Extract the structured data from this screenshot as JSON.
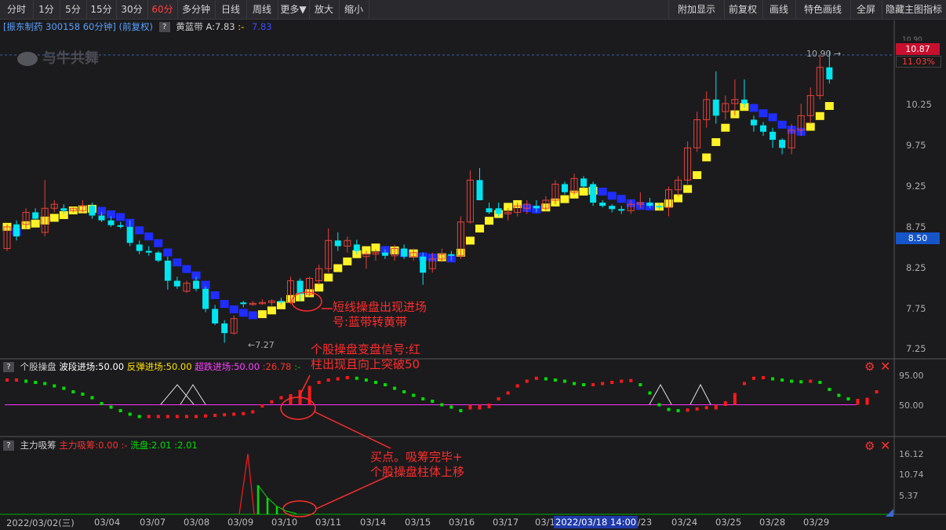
{
  "toolbar": {
    "left": [
      "分时",
      "1分",
      "5分",
      "15分",
      "30分",
      "60分",
      "多分钟",
      "日线",
      "周线",
      "更多▼",
      "放大",
      "缩小"
    ],
    "active": "60分",
    "right": [
      "附加显示",
      "前复权",
      "画线",
      "特色画线",
      "全屏",
      "隐藏主图指标"
    ]
  },
  "main_header": {
    "stock": "[振东制药 300158 60分钟]",
    "adjust": "(前复权)",
    "indicator": "黄蓝带",
    "value_a": "A:7.83",
    "sep": ":-",
    "value_b": "7.83"
  },
  "watermark": "与牛共舞",
  "price_axis": [
    "10.25",
    "9.75",
    "9.25",
    "8.75",
    "8.25",
    "7.75",
    "7.25"
  ],
  "price_tags": {
    "top": "10.87",
    "pct": "11.03%",
    "mid": "8.50",
    "top_axis_partial": "10.90"
  },
  "high_label": "10.90",
  "low_label": "7.27",
  "sub1": {
    "question": "?",
    "name": "个股操盘",
    "l1": "波段进场:50.00",
    "l2": "反弹进场:50.00",
    "l3": "超跌进场:50.00",
    "l4": ":26.78",
    "l5": ":-",
    "axis": [
      "95.00",
      "50.00"
    ]
  },
  "sub2": {
    "question": "?",
    "name": "主力吸筹",
    "l1": "主力吸筹:0.00",
    "l2": ":-",
    "l3": "洗盘:2.01",
    "l4": ":2.01",
    "axis": [
      "16.12",
      "10.74",
      "5.37"
    ]
  },
  "annotations": {
    "a1_line1": "短线操盘出现进场",
    "a1_line2": "号:蓝带转黄带",
    "a2_line1": "个股操盘变盘信号:红",
    "a2_line2": "柱出现且向上突破50",
    "a3_line1": "买点。吸筹完毕+",
    "a3_line2": "个股操盘柱体上移"
  },
  "date_axis": [
    "2022/03/02(三)",
    "03/04",
    "03/07",
    "03/08",
    "03/09",
    "03/10",
    "03/11",
    "03/14",
    "03/15",
    "03/16",
    "03/17",
    "03/1",
    "03/22",
    "03/23",
    "03/24",
    "03/25",
    "03/28",
    "03/29"
  ],
  "crosshair_date": "2022/03/18 14:00",
  "colors": {
    "bg": "#1b1b1d",
    "up": "#e8413a",
    "down": "#00e5f0",
    "band_yellow": "#fff227",
    "band_blue": "#1f2dff",
    "signal_green": "#00e000",
    "signal_red": "#ff1a1a",
    "midline": "#ff30ff",
    "annotation": "#ff2d2d"
  },
  "chart_data": {
    "type": "candlestick",
    "ylim": [
      7.1,
      11.0
    ],
    "candles": [
      [
        8.45,
        8.75,
        8.42,
        8.72
      ],
      [
        8.75,
        8.8,
        8.55,
        8.6
      ],
      [
        8.75,
        8.95,
        8.7,
        8.9
      ],
      [
        8.9,
        8.95,
        8.8,
        8.82
      ],
      [
        8.65,
        9.3,
        8.6,
        8.95
      ],
      [
        8.95,
        9.05,
        8.9,
        9.0
      ],
      [
        8.95,
        9.0,
        8.88,
        8.92
      ],
      [
        8.92,
        8.96,
        8.9,
        8.95
      ],
      [
        8.92,
        9.05,
        8.9,
        8.98
      ],
      [
        8.98,
        9.02,
        8.82,
        8.86
      ],
      [
        8.86,
        8.9,
        8.78,
        8.8
      ],
      [
        8.8,
        8.85,
        8.72,
        8.74
      ],
      [
        8.74,
        8.78,
        8.7,
        8.72
      ],
      [
        8.72,
        8.8,
        8.48,
        8.52
      ],
      [
        8.5,
        8.55,
        8.38,
        8.42
      ],
      [
        8.42,
        8.48,
        8.36,
        8.4
      ],
      [
        8.4,
        8.42,
        8.28,
        8.3
      ],
      [
        8.3,
        8.35,
        7.94,
        8.05
      ],
      [
        8.05,
        8.1,
        7.95,
        7.98
      ],
      [
        7.92,
        8.05,
        7.9,
        8.02
      ],
      [
        8.05,
        8.1,
        7.92,
        7.95
      ],
      [
        7.95,
        7.98,
        7.66,
        7.7
      ],
      [
        7.7,
        7.75,
        7.5,
        7.52
      ],
      [
        7.52,
        7.56,
        7.28,
        7.4
      ],
      [
        7.4,
        7.62,
        7.38,
        7.58
      ],
      [
        7.78,
        7.8,
        7.72,
        7.76
      ],
      [
        7.76,
        7.8,
        7.74,
        7.77
      ],
      [
        7.77,
        7.82,
        7.75,
        7.78
      ],
      [
        7.78,
        7.82,
        7.74,
        7.8
      ],
      [
        7.8,
        7.84,
        7.75,
        7.78
      ],
      [
        7.78,
        8.1,
        7.76,
        8.05
      ],
      [
        8.05,
        8.08,
        7.8,
        7.88
      ],
      [
        7.88,
        8.1,
        7.86,
        8.08
      ],
      [
        8.05,
        8.25,
        8.0,
        8.2
      ],
      [
        8.2,
        8.7,
        8.15,
        8.55
      ],
      [
        8.55,
        8.65,
        8.42,
        8.48
      ],
      [
        8.48,
        8.6,
        8.4,
        8.55
      ],
      [
        8.5,
        8.56,
        8.38,
        8.42
      ],
      [
        8.35,
        8.42,
        8.2,
        8.38
      ],
      [
        8.38,
        8.44,
        8.3,
        8.4
      ],
      [
        8.4,
        8.44,
        8.32,
        8.36
      ],
      [
        8.36,
        8.5,
        8.3,
        8.45
      ],
      [
        8.45,
        8.5,
        8.32,
        8.35
      ],
      [
        8.35,
        8.45,
        8.3,
        8.4
      ],
      [
        8.35,
        8.4,
        8.0,
        8.15
      ],
      [
        8.2,
        8.4,
        8.15,
        8.32
      ],
      [
        8.32,
        8.45,
        8.28,
        8.38
      ],
      [
        8.38,
        8.42,
        8.3,
        8.36
      ],
      [
        8.36,
        8.85,
        8.32,
        8.78
      ],
      [
        8.78,
        9.42,
        8.76,
        9.3
      ],
      [
        9.3,
        9.45,
        9.05,
        9.05
      ],
      [
        8.95,
        9.02,
        8.88,
        8.9
      ],
      [
        8.95,
        9.02,
        8.85,
        8.88
      ],
      [
        8.88,
        8.95,
        8.8,
        8.9
      ],
      [
        8.9,
        9.02,
        8.85,
        8.98
      ],
      [
        8.95,
        9.05,
        8.88,
        9.0
      ],
      [
        8.98,
        9.05,
        8.9,
        8.95
      ],
      [
        8.95,
        9.1,
        8.92,
        9.05
      ],
      [
        9.05,
        9.3,
        9.0,
        9.25
      ],
      [
        9.25,
        9.28,
        9.12,
        9.15
      ],
      [
        9.15,
        9.38,
        9.12,
        9.32
      ],
      [
        9.32,
        9.35,
        9.2,
        9.22
      ],
      [
        9.25,
        9.28,
        8.98,
        9.02
      ],
      [
        9.02,
        9.05,
        8.96,
        8.98
      ],
      [
        8.98,
        9.0,
        8.9,
        8.94
      ],
      [
        8.94,
        8.98,
        8.88,
        8.92
      ],
      [
        8.92,
        9.05,
        8.88,
        9.0
      ],
      [
        9.0,
        9.15,
        8.95,
        9.02
      ],
      [
        9.02,
        9.08,
        8.95,
        8.98
      ],
      [
        8.98,
        9.02,
        8.93,
        8.96
      ],
      [
        8.96,
        9.22,
        8.85,
        9.18
      ],
      [
        9.18,
        9.35,
        9.1,
        9.3
      ],
      [
        9.3,
        9.78,
        9.25,
        9.7
      ],
      [
        9.7,
        10.15,
        9.65,
        10.05
      ],
      [
        10.05,
        10.4,
        9.95,
        10.3
      ],
      [
        10.3,
        10.65,
        10.0,
        10.1
      ],
      [
        10.15,
        10.35,
        10.05,
        10.25
      ],
      [
        10.25,
        10.55,
        10.1,
        10.3
      ],
      [
        10.3,
        10.55,
        10.2,
        10.25
      ],
      [
        10.05,
        10.1,
        9.9,
        9.98
      ],
      [
        9.98,
        10.02,
        9.85,
        9.9
      ],
      [
        9.9,
        9.95,
        9.7,
        9.8
      ],
      [
        9.8,
        9.82,
        9.62,
        9.7
      ],
      [
        9.7,
        10.0,
        9.62,
        9.92
      ],
      [
        9.92,
        10.25,
        9.85,
        10.1
      ],
      [
        10.1,
        10.45,
        10.0,
        10.35
      ],
      [
        10.35,
        10.85,
        10.3,
        10.7
      ],
      [
        10.7,
        10.9,
        10.5,
        10.55
      ]
    ],
    "sub1_values": [
      92,
      92,
      90,
      88,
      86,
      82,
      78,
      72,
      68,
      62,
      52,
      46,
      40,
      34,
      30,
      30,
      30,
      30,
      30,
      30,
      30,
      31,
      32,
      33,
      34,
      35,
      38,
      48,
      55,
      62,
      68,
      75,
      82,
      88,
      92,
      94,
      96,
      95,
      92,
      88,
      84,
      78,
      72,
      66,
      60,
      56,
      50,
      46,
      40,
      42,
      46,
      52,
      60,
      70,
      82,
      90,
      95,
      94,
      92,
      90,
      86,
      84,
      84,
      86,
      88,
      90,
      91,
      84,
      70,
      50,
      42,
      40,
      41,
      43,
      45,
      48,
      56,
      70,
      86,
      95,
      96,
      94,
      92,
      90,
      89,
      90,
      88,
      76,
      66,
      60,
      60,
      62,
      72
    ]
  }
}
